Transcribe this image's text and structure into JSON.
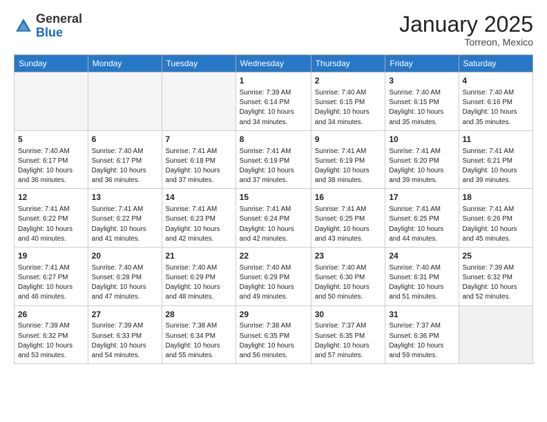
{
  "header": {
    "logo_general": "General",
    "logo_blue": "Blue",
    "month_title": "January 2025",
    "location": "Torreon, Mexico"
  },
  "days_of_week": [
    "Sunday",
    "Monday",
    "Tuesday",
    "Wednesday",
    "Thursday",
    "Friday",
    "Saturday"
  ],
  "weeks": [
    [
      {
        "day": "",
        "info": "",
        "empty": true
      },
      {
        "day": "",
        "info": "",
        "empty": true
      },
      {
        "day": "",
        "info": "",
        "empty": true
      },
      {
        "day": "1",
        "info": "Sunrise: 7:39 AM\nSunset: 6:14 PM\nDaylight: 10 hours\nand 34 minutes."
      },
      {
        "day": "2",
        "info": "Sunrise: 7:40 AM\nSunset: 6:15 PM\nDaylight: 10 hours\nand 34 minutes."
      },
      {
        "day": "3",
        "info": "Sunrise: 7:40 AM\nSunset: 6:15 PM\nDaylight: 10 hours\nand 35 minutes."
      },
      {
        "day": "4",
        "info": "Sunrise: 7:40 AM\nSunset: 6:16 PM\nDaylight: 10 hours\nand 35 minutes."
      }
    ],
    [
      {
        "day": "5",
        "info": "Sunrise: 7:40 AM\nSunset: 6:17 PM\nDaylight: 10 hours\nand 36 minutes."
      },
      {
        "day": "6",
        "info": "Sunrise: 7:40 AM\nSunset: 6:17 PM\nDaylight: 10 hours\nand 36 minutes."
      },
      {
        "day": "7",
        "info": "Sunrise: 7:41 AM\nSunset: 6:18 PM\nDaylight: 10 hours\nand 37 minutes."
      },
      {
        "day": "8",
        "info": "Sunrise: 7:41 AM\nSunset: 6:19 PM\nDaylight: 10 hours\nand 37 minutes."
      },
      {
        "day": "9",
        "info": "Sunrise: 7:41 AM\nSunset: 6:19 PM\nDaylight: 10 hours\nand 38 minutes."
      },
      {
        "day": "10",
        "info": "Sunrise: 7:41 AM\nSunset: 6:20 PM\nDaylight: 10 hours\nand 39 minutes."
      },
      {
        "day": "11",
        "info": "Sunrise: 7:41 AM\nSunset: 6:21 PM\nDaylight: 10 hours\nand 39 minutes."
      }
    ],
    [
      {
        "day": "12",
        "info": "Sunrise: 7:41 AM\nSunset: 6:22 PM\nDaylight: 10 hours\nand 40 minutes."
      },
      {
        "day": "13",
        "info": "Sunrise: 7:41 AM\nSunset: 6:22 PM\nDaylight: 10 hours\nand 41 minutes."
      },
      {
        "day": "14",
        "info": "Sunrise: 7:41 AM\nSunset: 6:23 PM\nDaylight: 10 hours\nand 42 minutes."
      },
      {
        "day": "15",
        "info": "Sunrise: 7:41 AM\nSunset: 6:24 PM\nDaylight: 10 hours\nand 42 minutes."
      },
      {
        "day": "16",
        "info": "Sunrise: 7:41 AM\nSunset: 6:25 PM\nDaylight: 10 hours\nand 43 minutes."
      },
      {
        "day": "17",
        "info": "Sunrise: 7:41 AM\nSunset: 6:25 PM\nDaylight: 10 hours\nand 44 minutes."
      },
      {
        "day": "18",
        "info": "Sunrise: 7:41 AM\nSunset: 6:26 PM\nDaylight: 10 hours\nand 45 minutes."
      }
    ],
    [
      {
        "day": "19",
        "info": "Sunrise: 7:41 AM\nSunset: 6:27 PM\nDaylight: 10 hours\nand 46 minutes."
      },
      {
        "day": "20",
        "info": "Sunrise: 7:40 AM\nSunset: 6:28 PM\nDaylight: 10 hours\nand 47 minutes."
      },
      {
        "day": "21",
        "info": "Sunrise: 7:40 AM\nSunset: 6:29 PM\nDaylight: 10 hours\nand 48 minutes."
      },
      {
        "day": "22",
        "info": "Sunrise: 7:40 AM\nSunset: 6:29 PM\nDaylight: 10 hours\nand 49 minutes."
      },
      {
        "day": "23",
        "info": "Sunrise: 7:40 AM\nSunset: 6:30 PM\nDaylight: 10 hours\nand 50 minutes."
      },
      {
        "day": "24",
        "info": "Sunrise: 7:40 AM\nSunset: 6:31 PM\nDaylight: 10 hours\nand 51 minutes."
      },
      {
        "day": "25",
        "info": "Sunrise: 7:39 AM\nSunset: 6:32 PM\nDaylight: 10 hours\nand 52 minutes."
      }
    ],
    [
      {
        "day": "26",
        "info": "Sunrise: 7:39 AM\nSunset: 6:32 PM\nDaylight: 10 hours\nand 53 minutes."
      },
      {
        "day": "27",
        "info": "Sunrise: 7:39 AM\nSunset: 6:33 PM\nDaylight: 10 hours\nand 54 minutes."
      },
      {
        "day": "28",
        "info": "Sunrise: 7:38 AM\nSunset: 6:34 PM\nDaylight: 10 hours\nand 55 minutes."
      },
      {
        "day": "29",
        "info": "Sunrise: 7:38 AM\nSunset: 6:35 PM\nDaylight: 10 hours\nand 56 minutes."
      },
      {
        "day": "30",
        "info": "Sunrise: 7:37 AM\nSunset: 6:35 PM\nDaylight: 10 hours\nand 57 minutes."
      },
      {
        "day": "31",
        "info": "Sunrise: 7:37 AM\nSunset: 6:36 PM\nDaylight: 10 hours\nand 59 minutes."
      },
      {
        "day": "",
        "info": "",
        "empty": true,
        "shaded": true
      }
    ]
  ]
}
